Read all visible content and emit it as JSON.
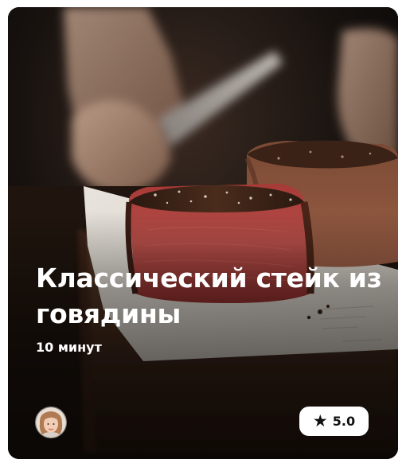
{
  "card": {
    "title": "Классический стейк из говядины",
    "duration": "10 минут",
    "rating": "5.0",
    "rating_icon": "star-icon",
    "avatar_icon": "author-avatar"
  }
}
